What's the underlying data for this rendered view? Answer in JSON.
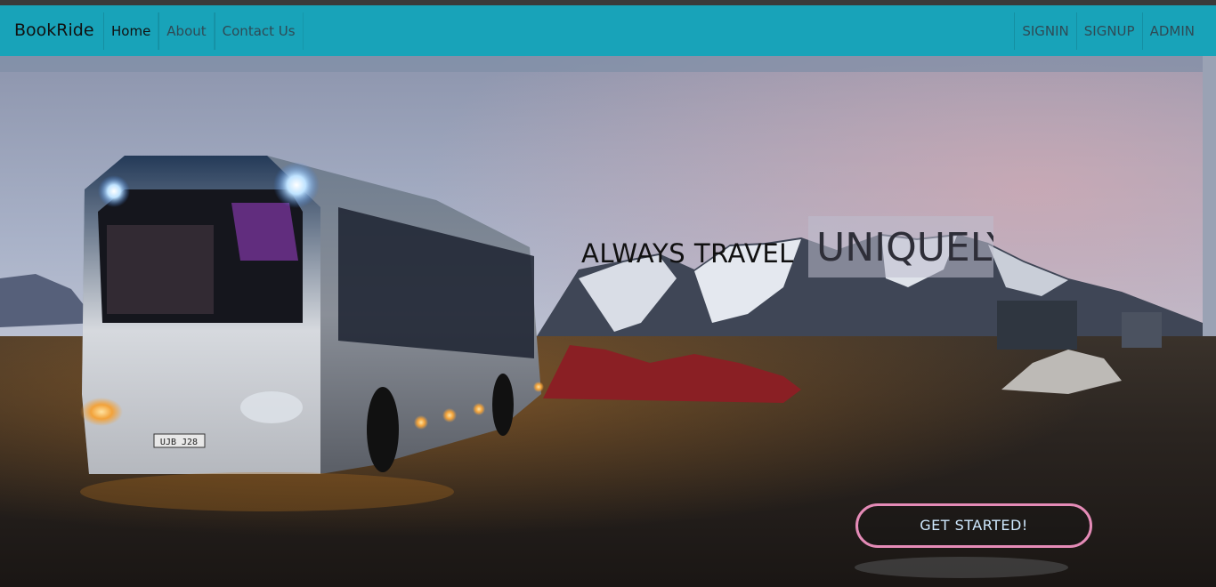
{
  "navbar": {
    "brand": "BookRide",
    "links": [
      {
        "label": "Home",
        "active": true
      },
      {
        "label": "About",
        "active": false
      },
      {
        "label": "Contact Us",
        "active": false
      }
    ],
    "right_links": [
      {
        "label": "SIGNIN"
      },
      {
        "label": "SIGNUP"
      },
      {
        "label": "ADMIN"
      }
    ]
  },
  "hero": {
    "headline": "ALWAYS TRAVEL",
    "typed_word": "UNIQUELY",
    "cta_label": "GET STARTED!",
    "image_subject": "coach bus parked at dusk in front of snowy mountains",
    "bus_plate": "UJB J28"
  },
  "colors": {
    "navbar": "#18a3b9",
    "cta_border": "#e58bb7",
    "cta_text": "#cfe9ff"
  }
}
